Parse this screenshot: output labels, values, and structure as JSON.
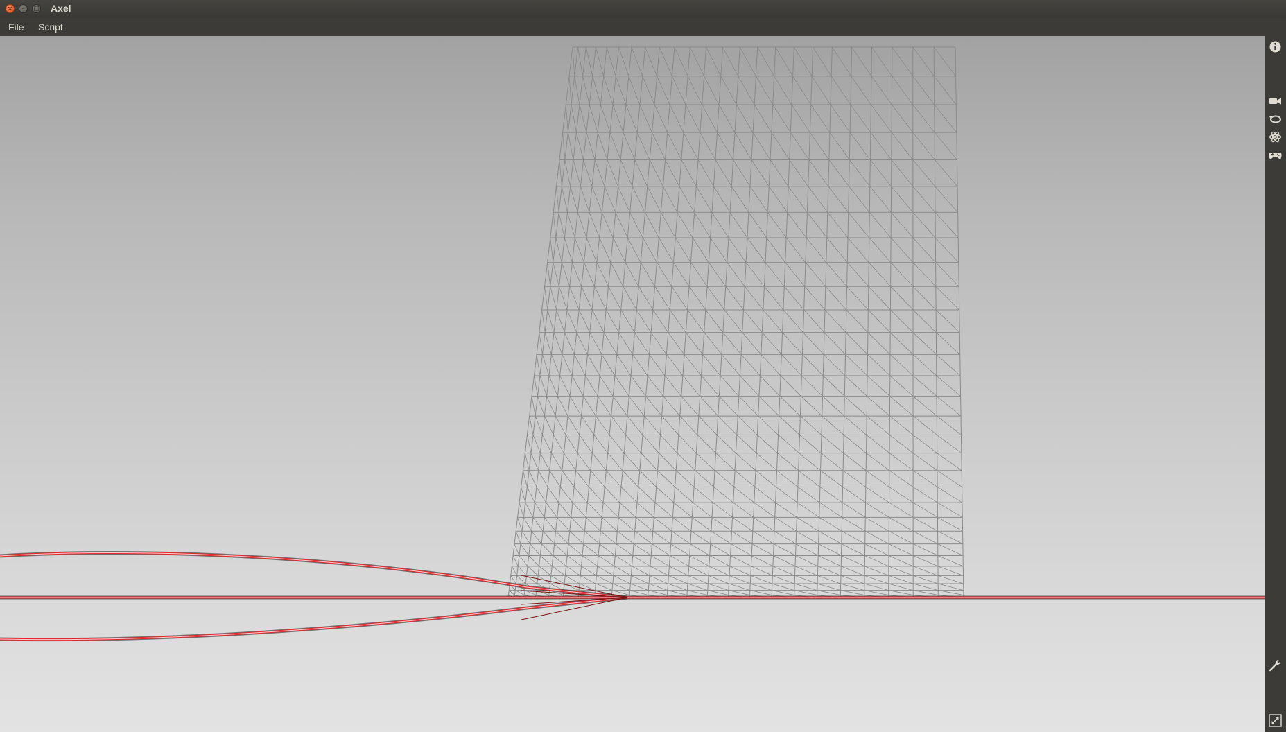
{
  "window": {
    "title": "Axel",
    "controls": {
      "close_glyph": "×",
      "minimize_glyph": "–",
      "maximize_glyph": "□"
    }
  },
  "menubar": {
    "items": [
      {
        "label": "File"
      },
      {
        "label": "Script"
      }
    ]
  },
  "viewport": {
    "background_top": "#a2a2a2",
    "background_bottom": "#e3e3e3",
    "mesh_color": "#8a8a8a",
    "curve_color": "#e3262b",
    "mesh_columns": 24,
    "mesh_rows": 30
  },
  "side_toolbar": {
    "icons": [
      "info-icon",
      "camera-icon",
      "rotate-icon",
      "atom-icon",
      "gamepad-icon",
      "wrench-icon",
      "fullscreen-icon"
    ]
  }
}
